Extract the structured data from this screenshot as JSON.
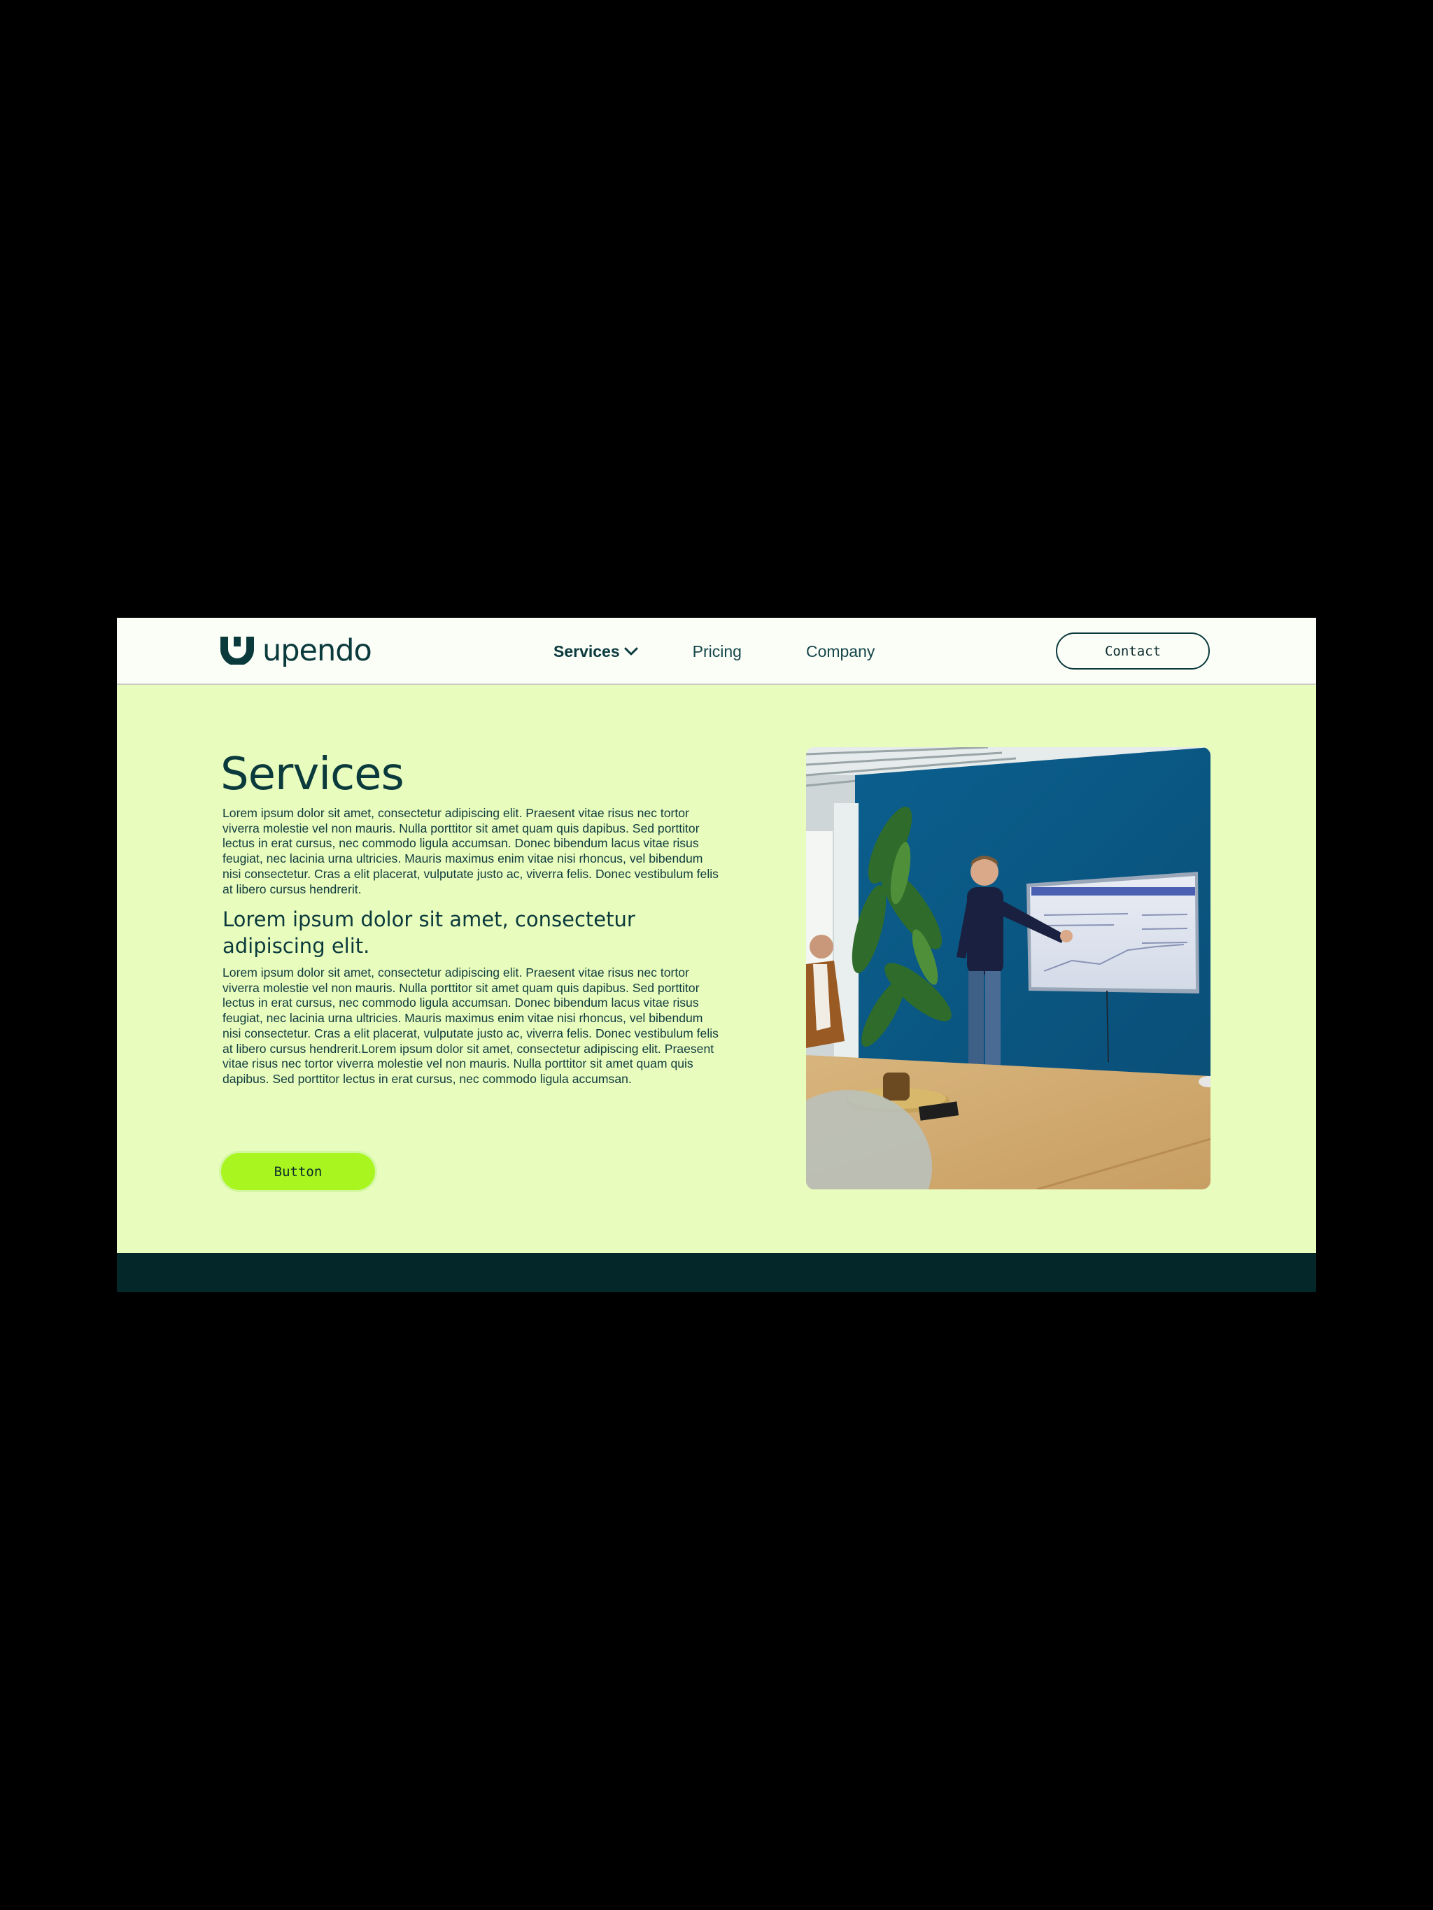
{
  "header": {
    "logo_text": "upendo",
    "nav": {
      "services": "Services",
      "pricing": "Pricing",
      "company": "Company"
    },
    "contact_label": "Contact"
  },
  "main": {
    "title": "Services",
    "paragraph1": "Lorem ipsum dolor sit amet, consectetur adipiscing elit. Praesent vitae risus nec tortor viverra molestie vel non mauris. Nulla porttitor sit amet quam quis dapibus. Sed porttitor lectus in erat cursus, nec commodo ligula accumsan. Donec bibendum lacus vitae risus feugiat, nec lacinia urna ultricies. Mauris maximus enim vitae nisi rhoncus, vel bibendum nisi consectetur. Cras a elit placerat, vulputate justo ac, viverra felis. Donec vestibulum felis at libero cursus hendrerit.",
    "subheading": "Lorem ipsum dolor sit amet, consectetur adipiscing elit.",
    "paragraph2": "Lorem ipsum dolor sit amet, consectetur adipiscing elit. Praesent vitae risus nec tortor viverra molestie vel non mauris. Nulla porttitor sit amet quam quis dapibus. Sed porttitor lectus in erat cursus, nec commodo ligula accumsan. Donec bibendum lacus vitae risus feugiat, nec lacinia urna ultricies. Mauris maximus enim vitae nisi rhoncus, vel bibendum nisi consectetur. Cras a elit placerat, vulputate justo ac, viverra felis. Donec vestibulum felis at libero cursus hendrerit.Lorem ipsum dolor sit amet, consectetur adipiscing elit. Praesent vitae risus nec tortor viverra molestie vel non mauris. Nulla porttitor sit amet quam quis dapibus. Sed porttitor lectus in erat cursus, nec commodo ligula accumsan.",
    "button_label": "Button"
  },
  "icons": {
    "logo": "upendo-logo-icon",
    "dropdown": "chevron-down-icon"
  },
  "colors": {
    "brand_dark": "#0b3a3d",
    "page_background": "#e8fcbd",
    "header_background": "#fbfdf7",
    "accent_lime": "#a8f51f",
    "footer": "#04282a"
  }
}
